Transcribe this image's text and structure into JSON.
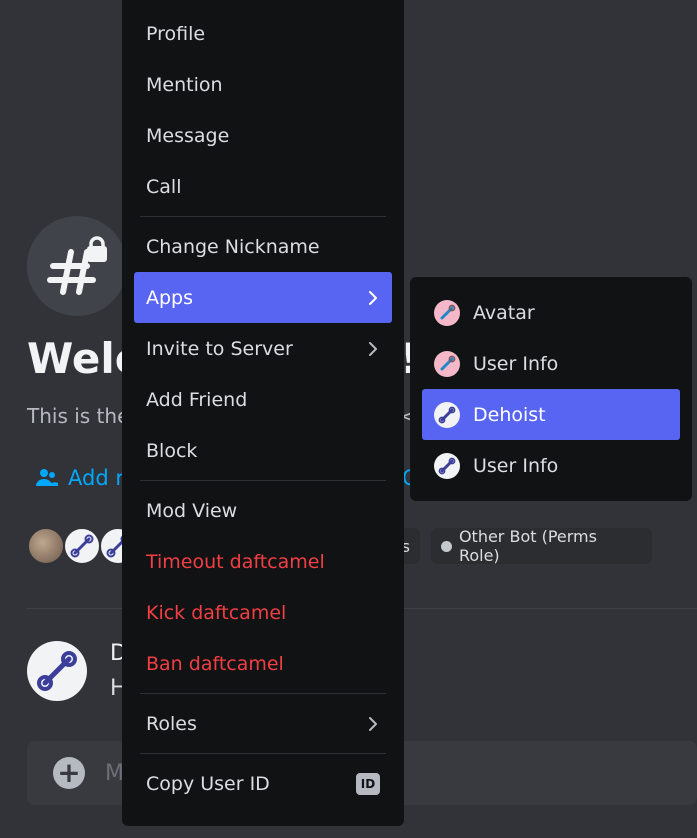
{
  "background": {
    "welcome_left": "Welc",
    "welcome_right": "!",
    "subtitle_left": "This is the",
    "subtitle_right": "<",
    "add_left": "Add r",
    "add_right": "C",
    "role_chip_left": "s",
    "role_chip_right": "Other Bot (Perms Role)",
    "message_author": "D",
    "message_text": "H",
    "composer_placeholder": "M"
  },
  "context_menu": {
    "items": [
      {
        "label": "Profile"
      },
      {
        "label": "Mention"
      },
      {
        "label": "Message"
      },
      {
        "label": "Call"
      },
      {
        "label": "Change Nickname"
      },
      {
        "label": "Apps"
      },
      {
        "label": "Invite to Server"
      },
      {
        "label": "Add Friend"
      },
      {
        "label": "Block"
      },
      {
        "label": "Mod View"
      },
      {
        "label": "Timeout daftcamel"
      },
      {
        "label": "Kick daftcamel"
      },
      {
        "label": "Ban daftcamel"
      },
      {
        "label": "Roles"
      },
      {
        "label": "Copy User ID"
      }
    ],
    "id_badge": "ID"
  },
  "apps_submenu": {
    "items": [
      {
        "label": "Avatar",
        "icon": "pink-wrench-bot-icon"
      },
      {
        "label": "User Info",
        "icon": "pink-wrench-bot-icon"
      },
      {
        "label": "Dehoist",
        "icon": "white-wrench-bot-icon"
      },
      {
        "label": "User Info",
        "icon": "white-wrench-bot-icon"
      }
    ]
  },
  "colors": {
    "accent": "#5865f2",
    "danger": "#f23f43",
    "menu_bg": "#111214",
    "page_bg": "#313338"
  }
}
